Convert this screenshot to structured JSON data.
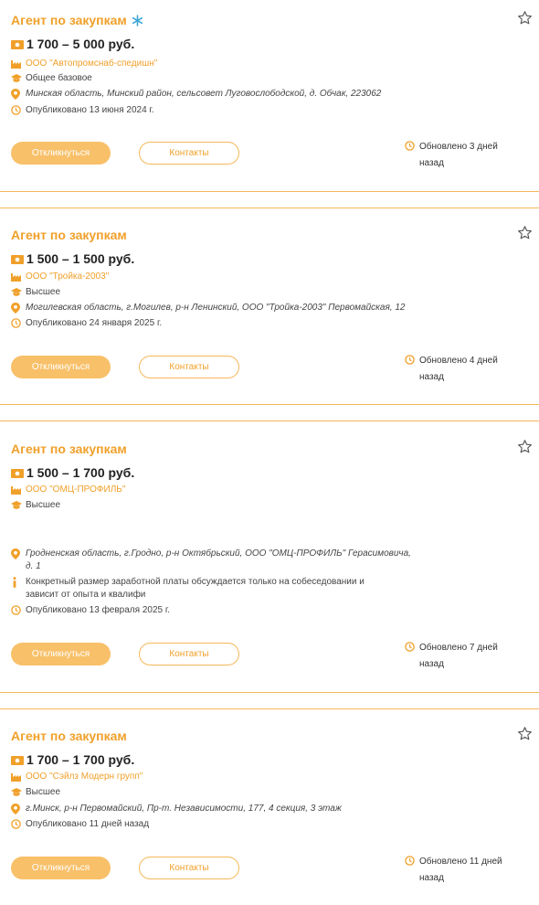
{
  "colors": {
    "accent": "#f0a02a",
    "button_fill": "#f8c069",
    "separator": "#f5b85a"
  },
  "vacancies": [
    {
      "title": "Агент по закупкам",
      "salary": "1 700 – 5 000 руб.",
      "company": "ООО \"Автопромснаб-спедишн\"",
      "education": "Общее базовое",
      "address": "Минская область, Минский район, сельсовет Луговослободской, д. Обчак, 223062",
      "published": "Опубликовано 13 июня 2024 г.",
      "respond_label": "Откликнуться",
      "contacts_label": "Контакты",
      "updated_line1": "Обновлено 3 дней",
      "updated_line2": "назад"
    },
    {
      "title": "Агент по закупкам",
      "salary": "1 500 – 1 500 руб.",
      "company": "ООО \"Тройка-2003\"",
      "education": "Высшее",
      "address": "Могилевская область, г.Могилев, р-н Ленинский, ООО \"Тройка-2003\" Первомайская, 12",
      "published": "Опубликовано 24 января 2025 г.",
      "respond_label": "Откликнуться",
      "contacts_label": "Контакты",
      "updated_line1": "Обновлено 4 дней",
      "updated_line2": "назад"
    },
    {
      "title": "Агент по закупкам",
      "salary": "1 500 – 1 700 руб.",
      "company": "ООО \"ОМЦ-ПРОФИЛЬ\"",
      "education": "Высшее",
      "address_line1": "Гродненская область, г.Гродно, р-н Октябрьский, ООО \"ОМЦ-ПРОФИЛЬ\" Герасимовича,",
      "address_line2": "д. 1",
      "note_line1": "Конкретный размер заработной платы обсуждается только на собеседовании и",
      "note_line2": "зависит от опыта и квалифи",
      "published": "Опубликовано 13 февраля 2025 г.",
      "respond_label": "Откликнуться",
      "contacts_label": "Контакты",
      "updated_line1": "Обновлено 7 дней",
      "updated_line2": "назад"
    },
    {
      "title": "Агент по закупкам",
      "salary": "1 700 – 1 700 руб.",
      "company": "ООО \"Сэйлз Модерн групп\"",
      "education": "Высшее",
      "address": "г.Минск, р-н Первомайский, Пр-т. Независимости, 177, 4 секция, 3 этаж",
      "published": "Опубликовано 11 дней назад",
      "respond_label": "Откликнуться",
      "contacts_label": "Контакты",
      "updated_line1": "Обновлено 11 дней",
      "updated_line2": "назад"
    }
  ]
}
